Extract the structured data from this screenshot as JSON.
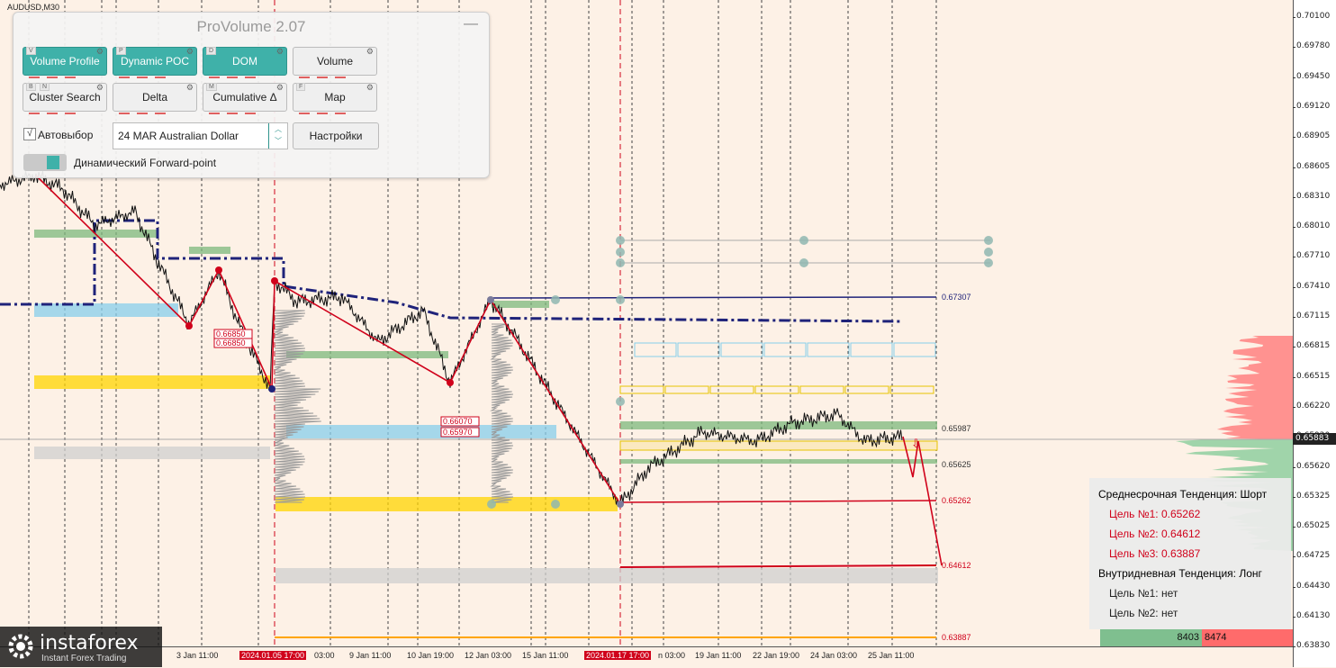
{
  "symbol": "AUDUSD,M30",
  "price_axis": [
    "0.70100",
    "0.69780",
    "0.69450",
    "0.69120",
    "0.68905",
    "0.68605",
    "0.68310",
    "0.68010",
    "0.67710",
    "0.67410",
    "0.67115",
    "0.66815",
    "0.66515",
    "0.66220",
    "0.65920",
    "0.65620",
    "0.65325",
    "0.65025",
    "0.64725",
    "0.64430",
    "0.64130",
    "0.63830"
  ],
  "current_price": "0.65883",
  "time_axis": [
    {
      "label": "3 Jan 11:00",
      "hl": false
    },
    {
      "label": "2024.01.05 17:00",
      "hl": true
    },
    {
      "label": "03:00",
      "hl": false
    },
    {
      "label": "9 Jan 11:00",
      "hl": false
    },
    {
      "label": "10 Jan 19:00",
      "hl": false
    },
    {
      "label": "12 Jan 03:00",
      "hl": false
    },
    {
      "label": "15 Jan 11:00",
      "hl": false
    },
    {
      "label": "2024.01.17 17:00",
      "hl": true
    },
    {
      "label": "n 03:00",
      "hl": false
    },
    {
      "label": "19 Jan 11:00",
      "hl": false
    },
    {
      "label": "22 Jan 19:00",
      "hl": false
    },
    {
      "label": "24 Jan 03:00",
      "hl": false
    },
    {
      "label": "25 Jan 11:00",
      "hl": false
    }
  ],
  "level_labels": [
    "0.67307",
    "0.65987",
    "0.65625",
    "0.65262",
    "0.64612",
    "0.63887"
  ],
  "price_boxes": [
    "0.66850",
    "0.66850",
    "0.66070",
    "0.65970"
  ],
  "panel": {
    "title": "ProVolume 2.07",
    "minimize": "—",
    "buttons": [
      {
        "label": "Volume Profile",
        "key": "V",
        "state": "active"
      },
      {
        "label": "Dynamic POC",
        "key": "P",
        "state": "active"
      },
      {
        "label": "DOM",
        "key": "D",
        "state": "active"
      },
      {
        "label": "Volume",
        "key": "",
        "state": "inactive"
      },
      {
        "label": "Cluster Search",
        "key": "B",
        "key2": "N",
        "state": "inactive"
      },
      {
        "label": "Delta",
        "key": "",
        "state": "inactive"
      },
      {
        "label": "Cumulative Δ",
        "key": "M",
        "state": "inactive"
      },
      {
        "label": "Map",
        "key": "F",
        "state": "inactive"
      }
    ],
    "auto_label": "Автовыбор",
    "auto_checked": "√",
    "contract": "24 MAR Australian Dollar",
    "settings_label": "Настройки",
    "forward_point_label": "Динамический Forward-point"
  },
  "forecast": {
    "mid_trend": "Среднесрочная Тенденция: Шорт",
    "mid_targets": [
      "Цель №1: 0.65262",
      "Цель №2: 0.64612",
      "Цель №3: 0.63887"
    ],
    "intraday_trend": "Внутридневная Тенденция: Лонг",
    "intraday_targets": [
      "Цель №1: нет",
      "Цель №2: нет"
    ]
  },
  "volume_bar": {
    "buy": "8403",
    "sell": "8474"
  },
  "watermark": {
    "name": "instaforex",
    "tagline": "Instant Forex Trading"
  },
  "colors": {
    "background": "#fdf1e6",
    "accent": "#3fb1a9",
    "target_line": "#d0021b",
    "poc_line": "#1f237a",
    "yellow_zone": "#ffd400",
    "blue_zone": "#87ceeb",
    "green_zone": "#7cb87c"
  }
}
